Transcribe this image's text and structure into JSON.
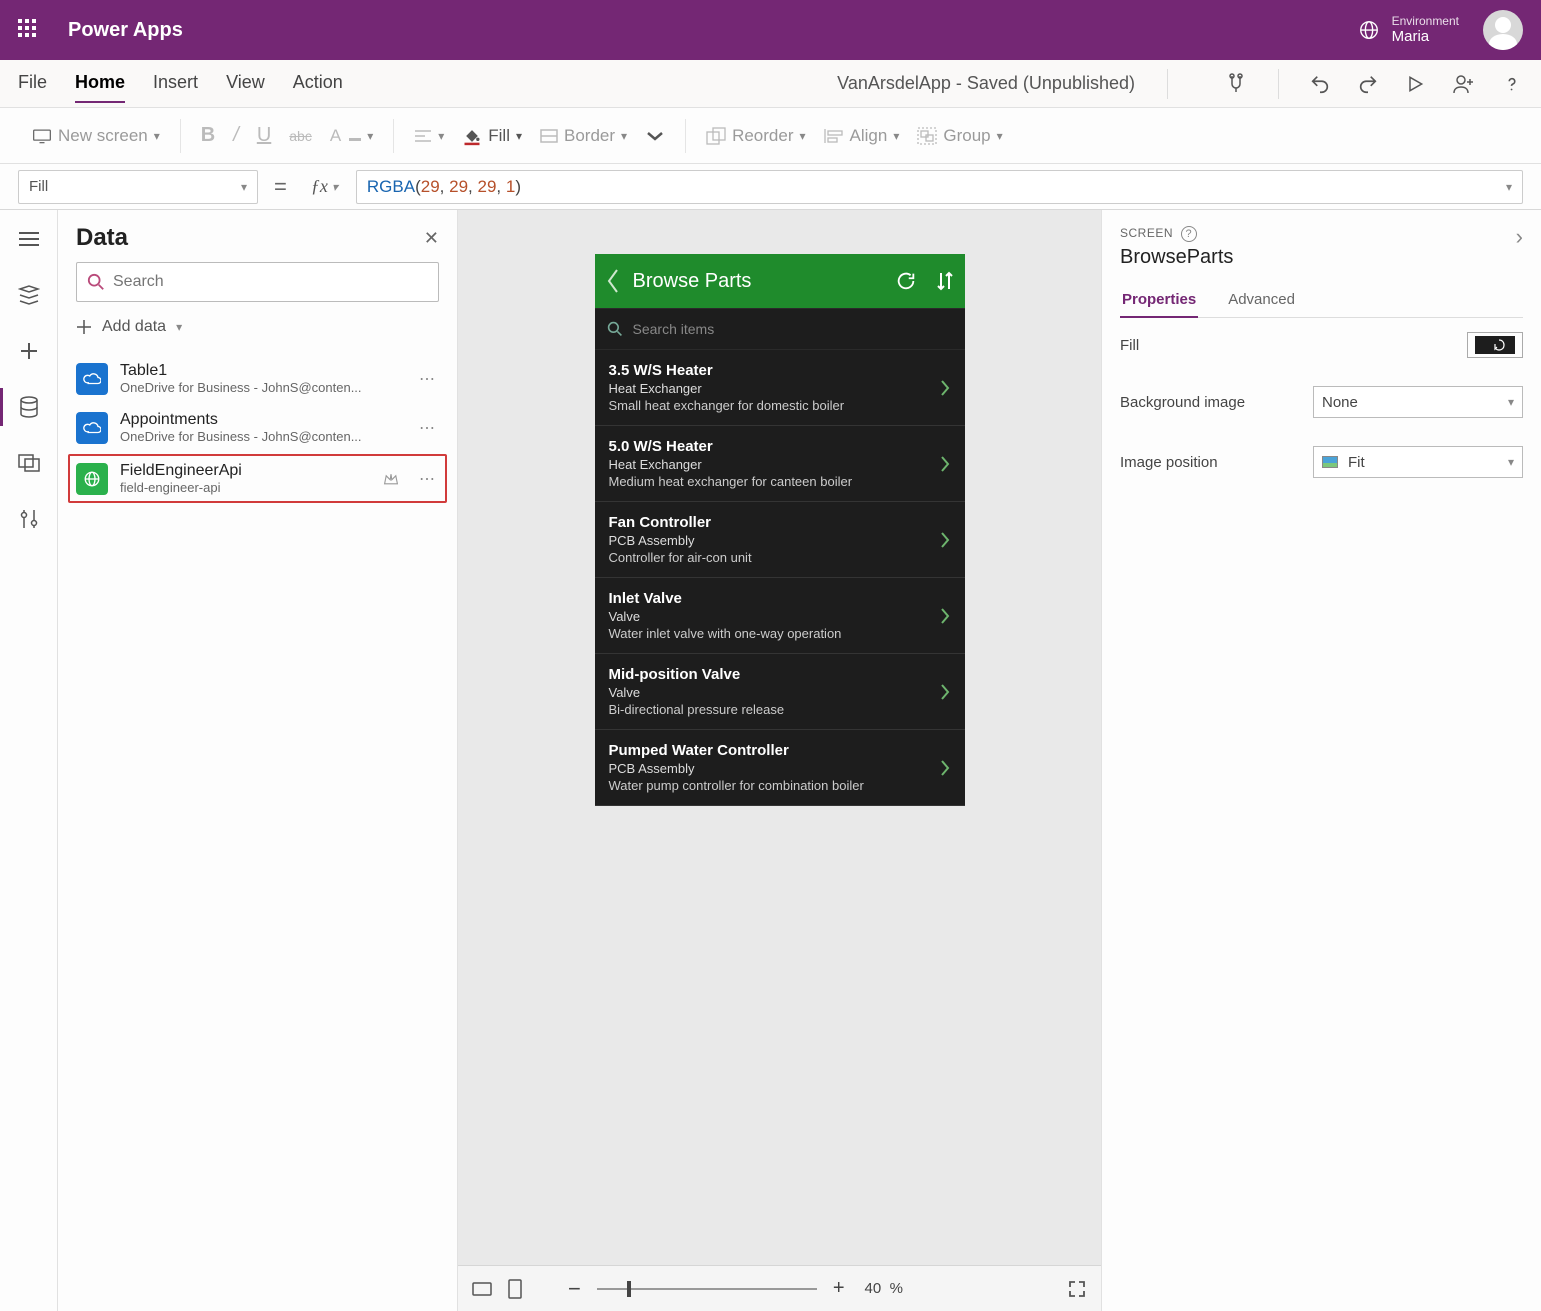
{
  "header": {
    "appTitle": "Power Apps",
    "envLabel": "Environment",
    "envName": "Maria"
  },
  "menu": {
    "tabs": [
      "File",
      "Home",
      "Insert",
      "View",
      "Action"
    ],
    "activeTab": "Home",
    "docTitle": "VanArsdelApp - Saved (Unpublished)"
  },
  "ribbon": {
    "newScreen": "New screen",
    "fill": "Fill",
    "border": "Border",
    "reorder": "Reorder",
    "align": "Align",
    "group": "Group"
  },
  "formula": {
    "property": "Fill",
    "fn": "RGBA",
    "args": [
      "29",
      "29",
      "29",
      "1"
    ]
  },
  "dataPanel": {
    "title": "Data",
    "searchPlaceholder": "Search",
    "addData": "Add data",
    "sources": [
      {
        "icon": "blue",
        "name": "Table1",
        "sub": "OneDrive for Business - JohnS@conten...",
        "premium": false,
        "selected": false
      },
      {
        "icon": "blue",
        "name": "Appointments",
        "sub": "OneDrive for Business - JohnS@conten...",
        "premium": false,
        "selected": false
      },
      {
        "icon": "green",
        "name": "FieldEngineerApi",
        "sub": "field-engineer-api",
        "premium": true,
        "selected": true
      }
    ]
  },
  "phone": {
    "title": "Browse Parts",
    "searchPlaceholder": "Search items",
    "parts": [
      {
        "name": "3.5 W/S Heater",
        "cat": "Heat Exchanger",
        "desc": "Small heat exchanger for domestic boiler"
      },
      {
        "name": "5.0 W/S Heater",
        "cat": "Heat Exchanger",
        "desc": "Medium  heat exchanger for canteen boiler"
      },
      {
        "name": "Fan Controller",
        "cat": "PCB Assembly",
        "desc": "Controller for air-con unit"
      },
      {
        "name": "Inlet Valve",
        "cat": "Valve",
        "desc": "Water inlet valve with one-way operation"
      },
      {
        "name": "Mid-position Valve",
        "cat": "Valve",
        "desc": "Bi-directional pressure release"
      },
      {
        "name": "Pumped Water Controller",
        "cat": "PCB Assembly",
        "desc": "Water pump controller for combination boiler"
      }
    ]
  },
  "zoom": {
    "value": "40",
    "suffix": "%"
  },
  "props": {
    "sectionLabel": "SCREEN",
    "name": "BrowseParts",
    "tabs": [
      "Properties",
      "Advanced"
    ],
    "activeTab": "Properties",
    "rows": {
      "fillLabel": "Fill",
      "bgLabel": "Background image",
      "bgValue": "None",
      "imgPosLabel": "Image position",
      "imgPosValue": "Fit"
    }
  }
}
